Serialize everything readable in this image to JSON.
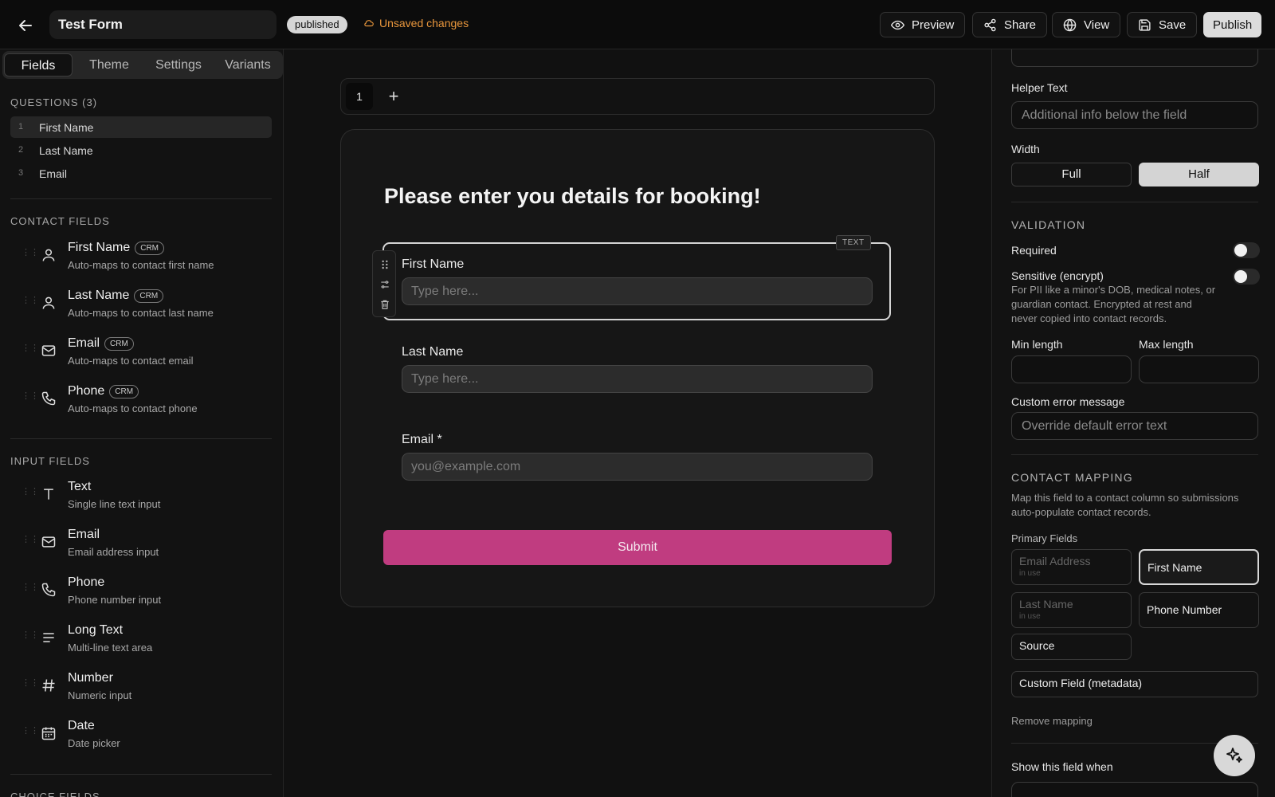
{
  "header": {
    "title": "Test Form",
    "status_badge": "published",
    "unsaved": "Unsaved changes",
    "buttons": {
      "preview": "Preview",
      "share": "Share",
      "view": "View",
      "save": "Save",
      "publish": "Publish"
    }
  },
  "left": {
    "tabs": [
      "Fields",
      "Theme",
      "Settings",
      "Variants"
    ],
    "questions_title": "QUESTIONS (3)",
    "questions": [
      {
        "num": "1",
        "label": "First Name"
      },
      {
        "num": "2",
        "label": "Last Name"
      },
      {
        "num": "3",
        "label": "Email"
      }
    ],
    "contact_title": "CONTACT FIELDS",
    "crm_tag": "CRM",
    "contact_fields": [
      {
        "name": "First Name",
        "desc": "Auto-maps to contact first name",
        "icon": "user-icon"
      },
      {
        "name": "Last Name",
        "desc": "Auto-maps to contact last name",
        "icon": "user-icon"
      },
      {
        "name": "Email",
        "desc": "Auto-maps to contact email",
        "icon": "mail-icon"
      },
      {
        "name": "Phone",
        "desc": "Auto-maps to contact phone",
        "icon": "phone-icon"
      }
    ],
    "input_title": "INPUT FIELDS",
    "input_fields": [
      {
        "name": "Text",
        "desc": "Single line text input",
        "icon": "text-icon"
      },
      {
        "name": "Email",
        "desc": "Email address input",
        "icon": "mail-icon"
      },
      {
        "name": "Phone",
        "desc": "Phone number input",
        "icon": "phone-icon"
      },
      {
        "name": "Long Text",
        "desc": "Multi-line text area",
        "icon": "paragraph-icon"
      },
      {
        "name": "Number",
        "desc": "Numeric input",
        "icon": "hash-icon"
      },
      {
        "name": "Date",
        "desc": "Date picker",
        "icon": "calendar-icon"
      }
    ],
    "choice_title": "CHOICE FIELDS"
  },
  "canvas": {
    "page_tab": "1",
    "add_page": "+",
    "form_title": "Please enter you details for booking!",
    "type_tag": "TEXT",
    "fields": [
      {
        "label": "First Name",
        "placeholder": "Type here..."
      },
      {
        "label": "Last Name",
        "placeholder": "Type here..."
      },
      {
        "label": "Email *",
        "placeholder": "you@example.com"
      }
    ],
    "submit": "Submit"
  },
  "right": {
    "helper_label": "Helper Text",
    "helper_placeholder": "Additional info below the field",
    "width_label": "Width",
    "width_options": [
      "Full",
      "Half"
    ],
    "width_selected": "Half",
    "validation_title": "VALIDATION",
    "required_label": "Required",
    "sensitive_label": "Sensitive (encrypt)",
    "sensitive_desc": "For PII like a minor's DOB, medical notes, or guardian contact. Encrypted at rest and never copied into contact records.",
    "min_label": "Min length",
    "max_label": "Max length",
    "error_label": "Custom error message",
    "error_placeholder": "Override default error text",
    "mapping_title": "CONTACT MAPPING",
    "mapping_desc": "Map this field to a contact column so submissions auto-populate contact records.",
    "primary_label": "Primary Fields",
    "in_use": "in use",
    "map_options": [
      "Email Address",
      "First Name",
      "Last Name",
      "Phone Number",
      "Source"
    ],
    "map_selected": "First Name",
    "custom_field": "Custom Field (metadata)",
    "remove_mapping": "Remove mapping",
    "show_when": "Show this field when"
  }
}
